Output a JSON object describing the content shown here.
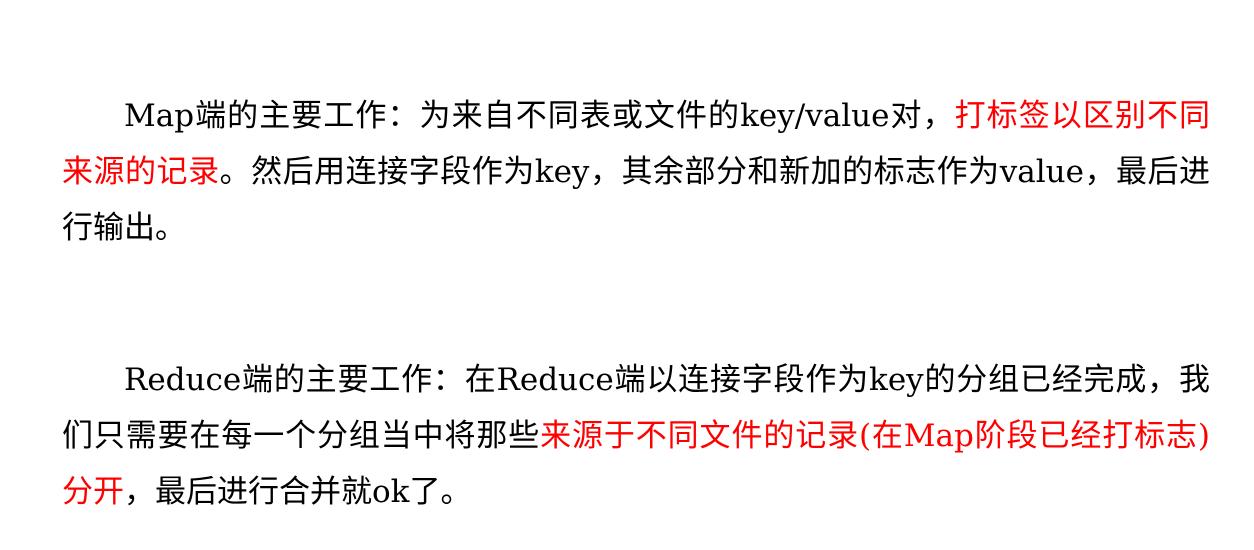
{
  "paragraphs": [
    {
      "segments": [
        {
          "text": "Map端的主要工作：为来自不同表或文件的key/value对，",
          "highlight": false
        },
        {
          "text": "打标签以区别不同来源的记录",
          "highlight": true
        },
        {
          "text": "。然后用连接字段作为key，其余部分和新加的标志作为value，最后进行输出。",
          "highlight": false
        }
      ]
    },
    {
      "segments": [
        {
          "text": "Reduce端的主要工作：在Reduce端以连接字段作为key的分组已经完成，我们只需要在每一个分组当中将那些",
          "highlight": false
        },
        {
          "text": "来源于不同文件的记录(在Map阶段已经打标志)分开",
          "highlight": true
        },
        {
          "text": "，最后进行合并就ok了。",
          "highlight": false
        }
      ]
    }
  ],
  "colors": {
    "text": "#000000",
    "highlight": "#ff0000",
    "background": "#ffffff"
  }
}
